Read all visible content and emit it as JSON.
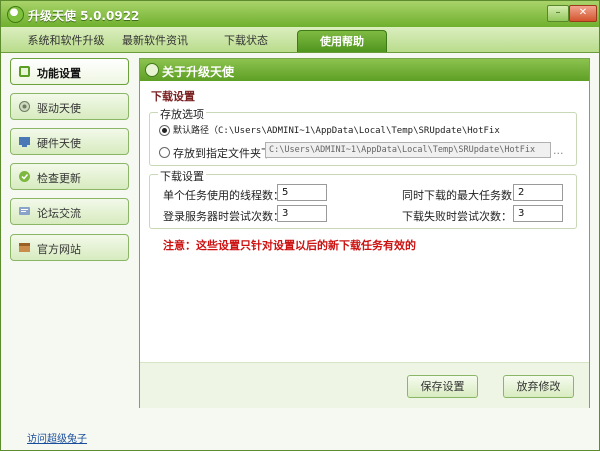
{
  "window": {
    "title": "升级天使 5.0.0922",
    "min_label": "–",
    "close_label": "✕"
  },
  "tabs": [
    {
      "label": "系统和软件升级"
    },
    {
      "label": "最新软件资讯"
    },
    {
      "label": "下载状态"
    },
    {
      "label": "使用帮助"
    }
  ],
  "sidebar": {
    "items": [
      {
        "label": "功能设置",
        "icon": "settings-icon"
      },
      {
        "label": "驱动天使",
        "icon": "driver-icon"
      },
      {
        "label": "硬件天使",
        "icon": "hardware-icon"
      },
      {
        "label": "检查更新",
        "icon": "update-icon"
      },
      {
        "label": "论坛交流",
        "icon": "forum-icon"
      },
      {
        "label": "官方网站",
        "icon": "website-icon"
      }
    ],
    "footer_link": "访问超级兔子"
  },
  "panel": {
    "title": "关于升级天使",
    "section_title": "下载设置",
    "storage": {
      "group_label": "存放选项",
      "default_option": "默认路径（C:\\Users\\ADMINI~1\\AppData\\Local\\Temp\\SRUpdate\\HotFix",
      "custom_option": "存放到指定文件夹下",
      "custom_path": "C:\\Users\\ADMINI~1\\AppData\\Local\\Temp\\SRUpdate\\HotFix",
      "browse_label": "..."
    },
    "download": {
      "group_label": "下载设置",
      "threads_label": "单个任务使用的线程数：",
      "threads_value": "5",
      "max_tasks_label": "同时下载的最大任务数：",
      "max_tasks_value": "2",
      "login_retry_label": "登录服务器时尝试次数：",
      "login_retry_value": "3",
      "fail_retry_label": "下载失败时尝试次数：",
      "fail_retry_value": "3"
    },
    "notice": "注意：这些设置只针对设置以后的新下载任务有效的",
    "save_button": "保存设置",
    "discard_button": "放弃修改"
  },
  "colors": {
    "accent": "#6fb02e",
    "notice": "#cc1111",
    "title": "#ffffff"
  }
}
